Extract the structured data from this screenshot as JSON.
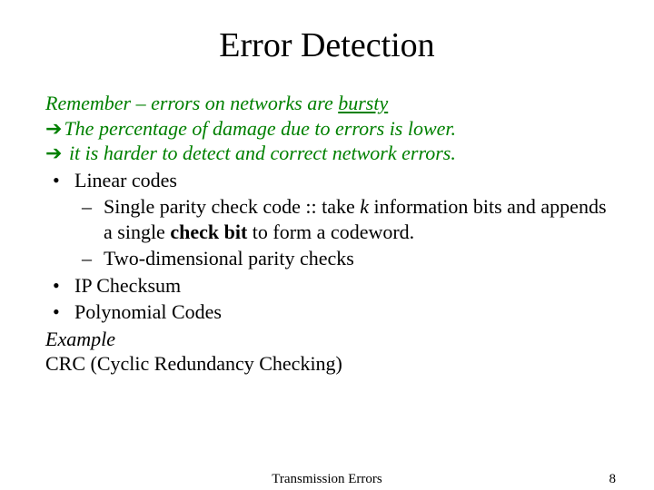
{
  "title": "Error Detection",
  "intro": {
    "remember_pre": "Remember – errors on networks are ",
    "remember_bursty": "bursty",
    "arrow1": "The percentage of damage due to errors is lower.",
    "arrow2": " it is harder to detect and correct network errors."
  },
  "bullets": {
    "linear": "Linear codes",
    "spcc_pre": "Single parity check code :: take ",
    "spcc_k": "k",
    "spcc_mid": " information bits and appends a single ",
    "spcc_checkbit": "check bit",
    "spcc_post": " to form a codeword.",
    "twod": "Two-dimensional parity checks",
    "ip": "IP Checksum",
    "poly": "Polynomial Codes"
  },
  "tail": {
    "example": "Example",
    "crc": "CRC (Cyclic Redundancy Checking)"
  },
  "footer": {
    "center": "Transmission Errors",
    "page": "8"
  }
}
